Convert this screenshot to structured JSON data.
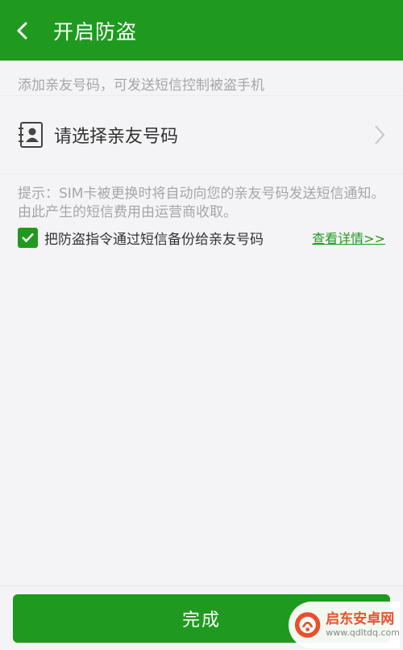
{
  "header": {
    "title": "开启防盗",
    "back_icon": "chevron-left-icon",
    "background": "#1f9a1f"
  },
  "intro_hint": "添加亲友号码，可发送短信控制被盗手机",
  "contact_row": {
    "label": "请选择亲友号码",
    "icon": "contact-card-icon",
    "arrow_icon": "chevron-right-icon"
  },
  "tip": "提示：SIM卡被更换时将自动向您的亲友号码发送短信通知。由此产生的短信费用由运营商收取。",
  "backup_option": {
    "checked": true,
    "label": "把防盗指令通过短信备份给亲友号码",
    "details_link": "查看详情>>"
  },
  "done_button": "完成",
  "watermark": {
    "name": "启东安卓网",
    "url": "www.qdltdq.com",
    "accent": "#e8502a"
  }
}
